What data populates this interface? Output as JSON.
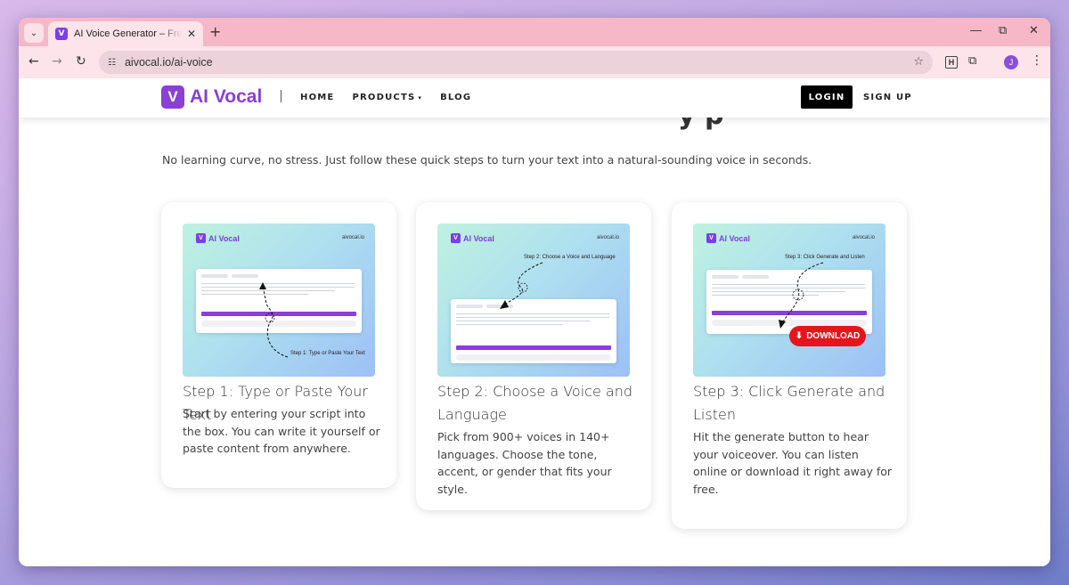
{
  "browser": {
    "tab_title": "AI Voice Generator – Free Text to Speech",
    "tab_favicon": "V",
    "url": "aivocal.io/ai-voice",
    "profile_initial": "J",
    "extension_label": "H"
  },
  "header": {
    "logo_mark": "V",
    "logo_text": "AI Vocal",
    "nav": [
      "HOME",
      "PRODUCTS",
      "BLOG"
    ],
    "login_label": "LOGIN",
    "signup_label": "SIGN UP"
  },
  "main": {
    "heading_peek": "y  p",
    "intro": "No learning curve, no stress. Just follow these quick steps to turn your text into a natural-sounding voice in seconds."
  },
  "cards": [
    {
      "image_brand": "AI Vocal",
      "image_domain": "aivocal.io",
      "image_caption": "Step 1: Type or Paste Your Text",
      "title": "Step 1: Type or Paste Your Text",
      "text": "Start by entering your script into the box. You can write it yourself or paste content from anywhere."
    },
    {
      "image_brand": "AI Vocal",
      "image_domain": "aivocal.io",
      "image_caption": "Step 2: Choose a Voice and Language",
      "title": "Step 2: Choose a Voice and Language",
      "text": "Pick from 900+ voices in 140+ languages. Choose the tone, accent, or gender that fits your style."
    },
    {
      "image_brand": "AI Vocal",
      "image_domain": "aivocal.io",
      "image_caption": "Step 3: Click Generate and Listen",
      "download_label": "DOWNLOAD",
      "title": "Step 3: Click Generate and Listen",
      "text": "Hit the generate button to hear your voiceover. You can listen online or download it right away for free."
    }
  ],
  "colors": {
    "brand": "#8a3fd6",
    "download": "#e5151b",
    "tabstrip": "#f6b7c6"
  }
}
